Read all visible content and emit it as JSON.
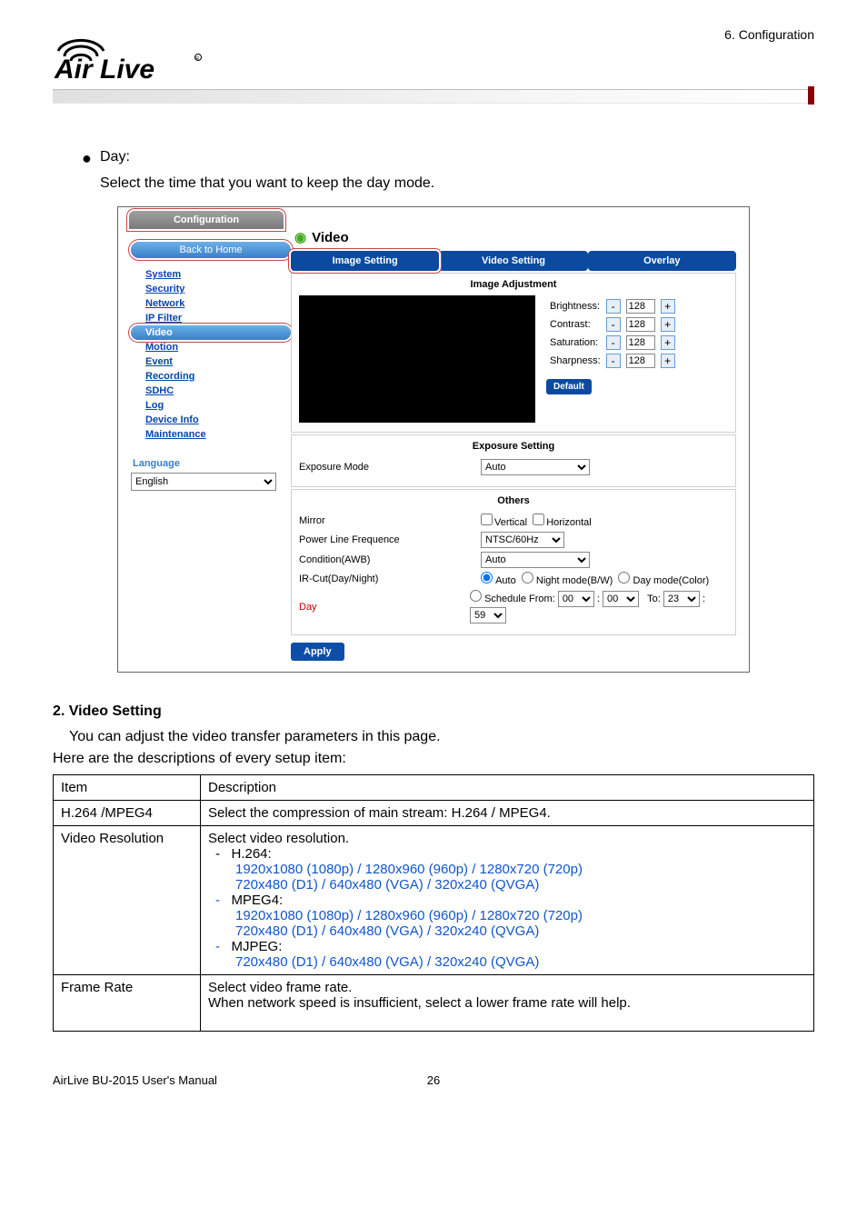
{
  "header": {
    "crumb": "6. Configuration"
  },
  "bullet": {
    "title": "Day:",
    "desc": "Select the time that you want to keep the day mode."
  },
  "screenshot": {
    "configuration_tab": "Configuration",
    "back_to_home": "Back to Home",
    "video_title": "Video",
    "nav": {
      "system": "System",
      "security": "Security",
      "network": "Network",
      "ip_filter": "IP Filter",
      "video": "Video",
      "motion": "Motion",
      "event": "Event",
      "recording": "Recording",
      "sdhc": "SDHC",
      "log": "Log",
      "device_info": "Device Info",
      "maintenance": "Maintenance"
    },
    "language_label": "Language",
    "language_value": "English",
    "tabs": {
      "image_setting": "Image Setting",
      "video_setting": "Video Setting",
      "overlay": "Overlay"
    },
    "img_adjustment": {
      "title": "Image Adjustment",
      "brightness": {
        "label": "Brightness:",
        "value": "128"
      },
      "contrast": {
        "label": "Contrast:",
        "value": "128"
      },
      "saturation": {
        "label": "Saturation:",
        "value": "128"
      },
      "sharpness": {
        "label": "Sharpness:",
        "value": "128"
      },
      "default_btn": "Default"
    },
    "exposure": {
      "title": "Exposure Setting",
      "mode_label": "Exposure Mode",
      "mode_value": "Auto"
    },
    "others": {
      "title": "Others",
      "mirror_label": "Mirror",
      "vertical": "Vertical",
      "horizontal": "Horizontal",
      "plf_label": "Power Line Frequence",
      "plf_value": "NTSC/60Hz",
      "condition_label": "Condition(AWB)",
      "condition_value": "Auto",
      "ircut_label": "IR-Cut(Day/Night)",
      "ircut_auto": "Auto",
      "ircut_night": "Night mode(B/W)",
      "ircut_day": "Day mode(Color)",
      "day_label": "Day",
      "schedule_from": "Schedule From:",
      "sched_h1": "00",
      "sched_m1": "00",
      "to_label": "To:",
      "sched_h2": "23",
      "sched_m2": "59"
    },
    "apply_btn": "Apply"
  },
  "section2": {
    "heading": "2. Video Setting",
    "line1": "You can adjust the video transfer parameters in this page.",
    "line2": "Here are the descriptions of every setup item:"
  },
  "table": {
    "hdr_item": "Item",
    "hdr_desc": "Description",
    "r1_item": "H.264 /MPEG4",
    "r1_desc": "Select the compression of main stream: H.264 / MPEG4.",
    "r2_item": "Video Resolution",
    "r2_l1": "Select video resolution.",
    "r2_h264": "H.264:",
    "r2_h264_a": "1920x1080 (1080p) / 1280x960 (960p) / 1280x720 (720p)",
    "r2_h264_b": "720x480 (D1) / 640x480 (VGA) / 320x240 (QVGA)",
    "r2_mpeg4": "MPEG4:",
    "r2_mpeg4_a": "1920x1080 (1080p) / 1280x960 (960p) / 1280x720 (720p)",
    "r2_mpeg4_b": "720x480 (D1) / 640x480 (VGA) / 320x240 (QVGA)",
    "r2_mjpeg": "MJPEG:",
    "r2_mjpeg_a": "720x480 (D1) / 640x480 (VGA) / 320x240 (QVGA)",
    "r3_item": "Frame Rate",
    "r3_l1": "Select video frame rate.",
    "r3_l2": "When network speed is insufficient, select a lower frame rate will help."
  },
  "footer": {
    "left": "AirLive BU-2015 User's Manual",
    "right": "26"
  }
}
